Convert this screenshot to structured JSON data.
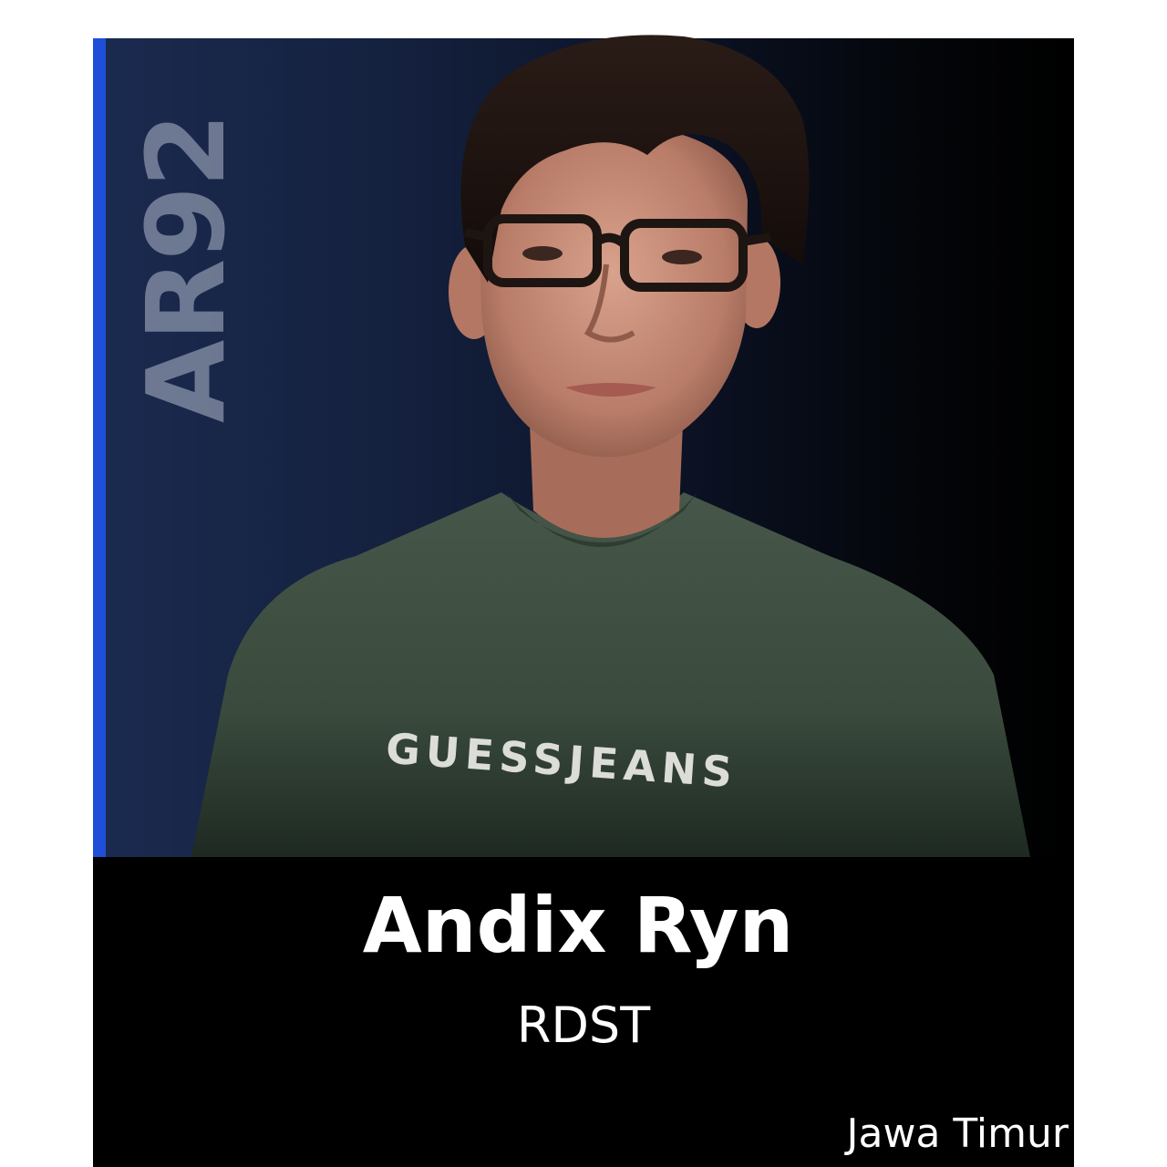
{
  "profile": {
    "player_name": "Andix Ryn",
    "team": "RDST",
    "region": "Jawa Timur",
    "watermark": "AR92",
    "shirt_text": "GUESSJEANS"
  },
  "colors": {
    "accent": "#1f4fd8",
    "watermark": "#8a93aa",
    "text": "#ffffff",
    "shirt": "#3b4a3c",
    "background_left": "#1b2a4f",
    "background_right": "#000000"
  }
}
